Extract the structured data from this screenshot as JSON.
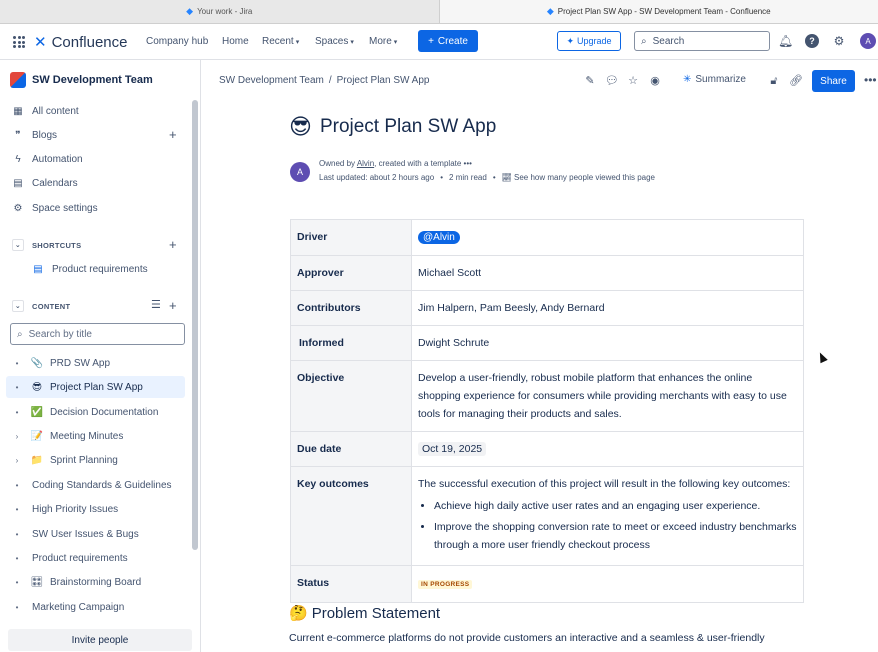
{
  "browser": {
    "tabs": [
      {
        "label": "Your work - Jira",
        "active": false
      },
      {
        "label": "Project Plan SW App - SW Development Team - Confluence",
        "active": true
      }
    ]
  },
  "topnav": {
    "app_name": "Confluence",
    "links": [
      "Company hub",
      "Home",
      "Recent",
      "Spaces",
      "More"
    ],
    "create_label": "Create",
    "upgrade_label": "Upgrade",
    "search_placeholder": "Search",
    "avatar_initial": "A"
  },
  "sidebar": {
    "space_name": "SW Development Team",
    "items": [
      "All content",
      "Blogs",
      "Automation",
      "Calendars",
      "Space settings"
    ],
    "shortcuts_heading": "SHORTCUTS",
    "shortcut_item": "Product requirements",
    "content_heading": "CONTENT",
    "search_placeholder": "Search by title",
    "tree": [
      {
        "label": "PRD SW App",
        "emoji": "📎",
        "lead": "•"
      },
      {
        "label": "Project Plan SW App",
        "emoji": "😎",
        "lead": "•",
        "selected": true
      },
      {
        "label": "Decision Documentation",
        "emoji": "✅",
        "lead": "•"
      },
      {
        "label": "Meeting Minutes",
        "emoji": "📝",
        "lead": "›"
      },
      {
        "label": "Sprint Planning",
        "emoji": "📁",
        "lead": "›"
      },
      {
        "label": "Coding Standards & Guidelines",
        "emoji": "",
        "lead": "•"
      },
      {
        "label": "High Priority Issues",
        "emoji": "",
        "lead": "•"
      },
      {
        "label": "SW User Issues & Bugs",
        "emoji": "",
        "lead": "•"
      },
      {
        "label": "Product requirements",
        "emoji": "",
        "lead": "•"
      },
      {
        "label": "Brainstorming Board",
        "emoji": "🎛",
        "lead": "•"
      },
      {
        "label": "Marketing Campaign",
        "emoji": "",
        "lead": "•"
      }
    ],
    "invite_label": "Invite people"
  },
  "page": {
    "breadcrumb": [
      "SW Development Team",
      "/",
      "Project Plan SW App"
    ],
    "summarize_label": "Summarize",
    "share_label": "Share",
    "title_emoji": "😎",
    "title": "Project Plan SW App",
    "byline": {
      "owned_prefix": "Owned by ",
      "owner": "Alvin",
      "owned_suffix": ", created with a template",
      "updated": "Last updated: about 2 hours ago",
      "sep": "•",
      "read_time": "2 min read",
      "views": "See how many people viewed this page",
      "avatar_initial": "A"
    },
    "props": {
      "driver_key": "Driver",
      "driver_val": "@Alvin",
      "approver_key": "Approver",
      "approver_val": "Michael Scott",
      "contributors_key": "Contributors",
      "contributors_val": "Jim Halpern, Pam Beesly, Andy Bernard",
      "informed_key": "Informed",
      "informed_val": "Dwight Schrute",
      "objective_key": "Objective",
      "objective_val": "Develop a user-friendly, robust mobile platform that enhances the online shopping experience for consumers while providing merchants with easy to use tools for managing their products and sales.",
      "due_key": "Due date",
      "due_val": "Oct 19, 2025",
      "outcomes_key": "Key outcomes",
      "outcomes_intro": "The successful execution of this project will result in the following key outcomes:",
      "outcome_1": "Achieve high daily active user rates and an engaging user experience.",
      "outcome_2": "Improve the shopping conversion rate to meet or exceed industry benchmarks through a more user friendly checkout process",
      "status_key": "Status",
      "status_val": "IN PROGRESS"
    },
    "section_emoji": "🤔",
    "section_title": "Problem Statement",
    "section_text": "Current e-commerce platforms do not provide customers an interactive and a seamless & user-friendly"
  },
  "colors": {
    "brand": "#0c66e4",
    "selected_bg": "#e9f2ff",
    "lozenge_bg": "#fff7d6",
    "lozenge_text": "#a54800"
  }
}
